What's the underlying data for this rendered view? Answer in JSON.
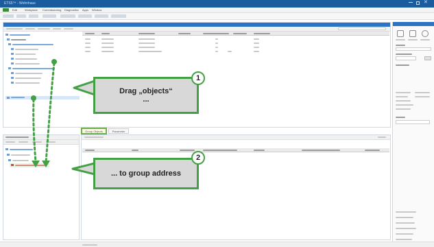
{
  "window": {
    "title": "ETS5™ - Wohnhaus"
  },
  "menu": {
    "items": [
      "Edit",
      "Workplace",
      "Commissioning",
      "Diagnostics",
      "Apps",
      "Window"
    ]
  },
  "tabs": {
    "group_objects": "Group Objects",
    "parameter": "Parameter"
  },
  "callouts": {
    "step1": {
      "number": "1",
      "line1": "Drag „objects“",
      "line2": "..."
    },
    "step2": {
      "number": "2",
      "line1": "... to group address"
    }
  },
  "colors": {
    "accent_green": "#44a045",
    "titlebar_blue": "#1a5c9e",
    "panel_blue": "#2b73c4"
  }
}
